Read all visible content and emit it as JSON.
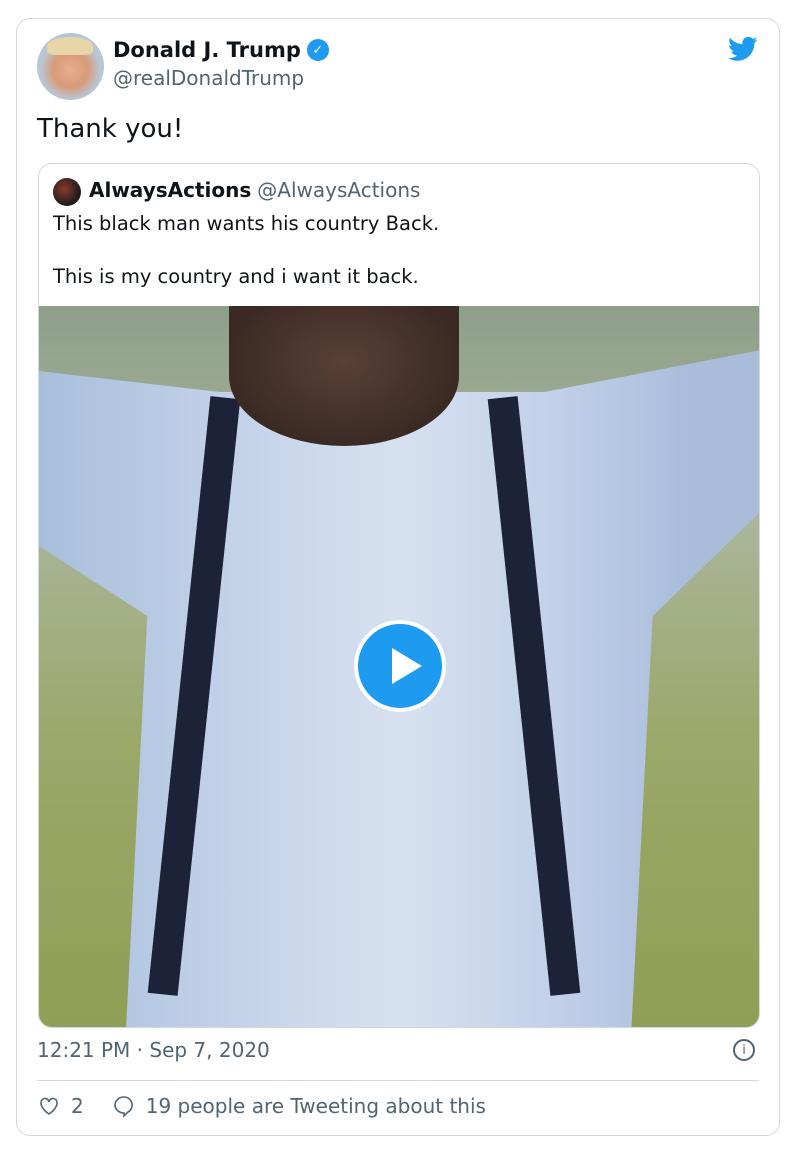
{
  "author": {
    "name": "Donald J. Trump",
    "handle": "@realDonaldTrump",
    "verified": true
  },
  "tweet_text": "Thank you!",
  "quoted": {
    "name": "AlwaysActions",
    "handle": "@AlwaysActions",
    "lines": [
      "This black man wants his country Back.",
      "This is my country and i want it back."
    ],
    "media": "video"
  },
  "timestamp": "12:21 PM · Sep 7, 2020",
  "actions": {
    "likes": "2",
    "conversation": "19 people are Tweeting about this"
  },
  "colors": {
    "accent": "#1d9bf0",
    "muted": "#536471",
    "border": "#cfd9de"
  }
}
